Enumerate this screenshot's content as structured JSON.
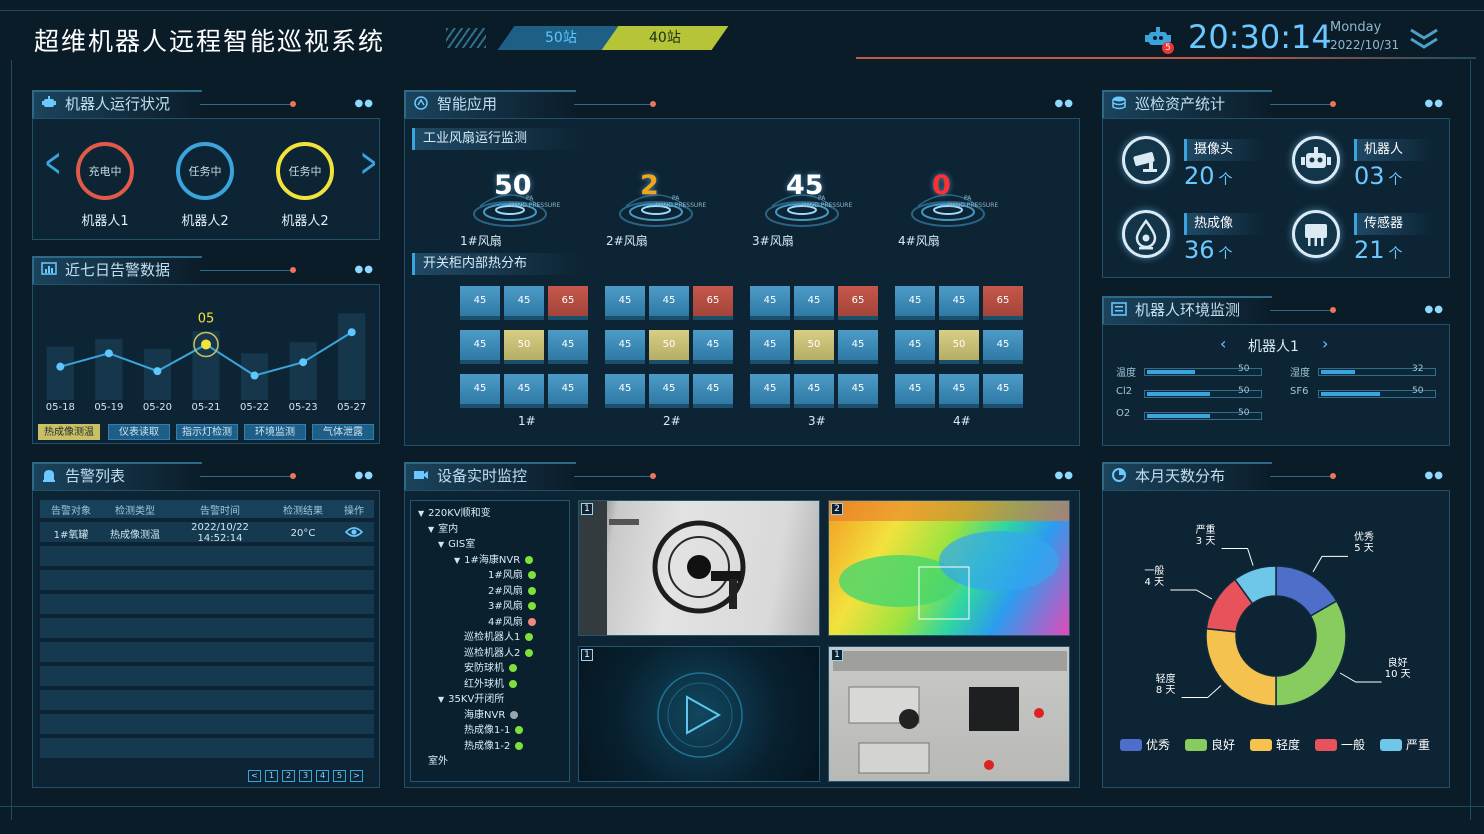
{
  "app": {
    "title": "超维机器人远程智能巡视系统"
  },
  "header": {
    "stations": [
      "50站",
      "40站"
    ],
    "time": "20:30:14",
    "weekday": "Monday",
    "date": "2022/10/31",
    "notify_count": "5"
  },
  "colors": {
    "accent": "#3ba4dc",
    "accent_light": "#6cc9ff",
    "warn_red": "#c6574a",
    "warn_yellow": "#d8cf85",
    "station_active": "#b6c437"
  },
  "robot_status": {
    "title": "机器人运行状况",
    "robots": [
      {
        "state": "充电中",
        "name": "机器人1",
        "color": "#e05a4a"
      },
      {
        "state": "任务中",
        "name": "机器人2",
        "color": "#3ba4dc"
      },
      {
        "state": "任务中",
        "name": "机器人2",
        "color": "#f2e33c"
      }
    ]
  },
  "alarm7": {
    "title": "近七日告警数据",
    "highlight": "05",
    "tabs": [
      "热成像测温",
      "仪表读取",
      "指示灯检测",
      "环境监测",
      "气体泄露"
    ],
    "selected_tab": 0
  },
  "chart_data": {
    "type": "line",
    "categories": [
      "05-18",
      "05-19",
      "05-20",
      "05-21",
      "05-22",
      "05-23",
      "05-27"
    ],
    "values": [
      3,
      4.2,
      2.6,
      5,
      2.2,
      3.4,
      6.1
    ],
    "bar_values": [
      4.8,
      5.5,
      4.6,
      6.2,
      4.2,
      5.2,
      7.8
    ],
    "ylim": [
      0,
      9
    ],
    "highlight_index": 3,
    "grid": false
  },
  "alarm_list": {
    "title": "告警列表",
    "columns": [
      "告警对象",
      "检测类型",
      "告警时间",
      "检测结果",
      "操作"
    ],
    "rows": [
      {
        "object": "1#氧罐",
        "type": "热成像测温",
        "time": "2022/10/22 14:52:14",
        "result": "20°C",
        "action_icon": "eye-icon"
      }
    ],
    "pager": [
      "<",
      "1",
      "2",
      "3",
      "4",
      "5",
      ">"
    ]
  },
  "smart_app": {
    "title": "智能应用",
    "fan_section": "工业风扇运行监测",
    "fans": [
      {
        "value": "50",
        "label": "1#风扇",
        "color": "#ffffff"
      },
      {
        "value": "2",
        "label": "2#风扇",
        "color": "#f3a51a"
      },
      {
        "value": "45",
        "label": "3#风扇",
        "color": "#ffffff"
      },
      {
        "value": "0",
        "label": "4#风扇",
        "color": "#ff3030"
      }
    ],
    "fan_unit": "PA",
    "fan_sub": "WIND PRESSURE",
    "heat_section": "开关柜内部热分布",
    "cabinets": [
      {
        "label": "1#",
        "cells": [
          [
            "45",
            "45",
            "65"
          ],
          [
            "45",
            "50",
            "45"
          ],
          [
            "45",
            "45",
            "45"
          ]
        ]
      },
      {
        "label": "2#",
        "cells": [
          [
            "45",
            "45",
            "65"
          ],
          [
            "45",
            "50",
            "45"
          ],
          [
            "45",
            "45",
            "45"
          ]
        ]
      },
      {
        "label": "3#",
        "cells": [
          [
            "45",
            "45",
            "65"
          ],
          [
            "45",
            "50",
            "45"
          ],
          [
            "45",
            "45",
            "45"
          ]
        ]
      },
      {
        "label": "4#",
        "cells": [
          [
            "45",
            "45",
            "65"
          ],
          [
            "45",
            "50",
            "45"
          ],
          [
            "45",
            "45",
            "45"
          ]
        ]
      }
    ]
  },
  "device_monitor": {
    "title": "设备实时监控",
    "tree": [
      {
        "label": "220KV顺和变",
        "level": 0,
        "toggle": true
      },
      {
        "label": "室内",
        "level": 1,
        "toggle": true
      },
      {
        "label": "GIS室",
        "level": 2,
        "toggle": true
      },
      {
        "label": "1#海康NVR",
        "level": 3,
        "toggle": true,
        "dot": "#7ee03a"
      },
      {
        "label": "1#风扇",
        "level": 4,
        "dot": "#7ee03a"
      },
      {
        "label": "2#风扇",
        "level": 4,
        "dot": "#7ee03a"
      },
      {
        "label": "3#风扇",
        "level": 4,
        "dot": "#7ee03a"
      },
      {
        "label": "4#风扇",
        "level": 4,
        "dot": "#f08a80"
      },
      {
        "label": "巡检机器人1",
        "level": 3,
        "dot": "#7ee03a"
      },
      {
        "label": "巡检机器人2",
        "level": 3,
        "dot": "#7ee03a"
      },
      {
        "label": "安防球机",
        "level": 3,
        "dot": "#7ee03a"
      },
      {
        "label": "红外球机",
        "level": 3,
        "dot": "#7ee03a"
      },
      {
        "label": "35KV开闭所",
        "level": 2,
        "toggle": true
      },
      {
        "label": "海康NVR",
        "level": 3,
        "dot": "#9aa5ad"
      },
      {
        "label": "热成像1-1",
        "level": 3,
        "dot": "#7ee03a"
      },
      {
        "label": "热成像1-2",
        "level": 3,
        "dot": "#7ee03a"
      },
      {
        "label": "室外",
        "level": 1
      }
    ],
    "videos": [
      "1",
      "2",
      "1",
      "1"
    ]
  },
  "assets": {
    "title": "巡检资产统计",
    "items": [
      {
        "name": "摄像头",
        "value": "20",
        "unit": "个",
        "icon": "camera-icon"
      },
      {
        "name": "机器人",
        "value": "03",
        "unit": "个",
        "icon": "robot-icon"
      },
      {
        "name": "热成像",
        "value": "36",
        "unit": "个",
        "icon": "thermal-icon"
      },
      {
        "name": "传感器",
        "value": "21",
        "unit": "个",
        "icon": "sensor-icon"
      }
    ]
  },
  "env": {
    "title": "机器人环境监测",
    "robot": "机器人1",
    "metrics": [
      {
        "label": "温度",
        "value": "50",
        "frac": 0.42
      },
      {
        "label": "湿度",
        "value": "32",
        "frac": 0.3
      },
      {
        "label": "Cl2",
        "value": "50",
        "frac": 0.55
      },
      {
        "label": "SF6",
        "value": "50",
        "frac": 0.52
      },
      {
        "label": "O2",
        "value": "50",
        "frac": 0.55
      }
    ]
  },
  "month": {
    "title": "本月天数分布",
    "slices": [
      {
        "name": "优秀",
        "days": 5,
        "label": "优秀\n5 天",
        "color": "#4d6fc9"
      },
      {
        "name": "良好",
        "days": 10,
        "label": "良好\n10 天",
        "color": "#88cc5f"
      },
      {
        "name": "轻度",
        "days": 8,
        "label": "轻度\n8 天",
        "color": "#f6c24f"
      },
      {
        "name": "一般",
        "days": 4,
        "label": "一般\n4 天",
        "color": "#e8525b"
      },
      {
        "name": "严重",
        "days": 3,
        "label": "严重\n3 天",
        "color": "#6ec6e8"
      }
    ]
  }
}
